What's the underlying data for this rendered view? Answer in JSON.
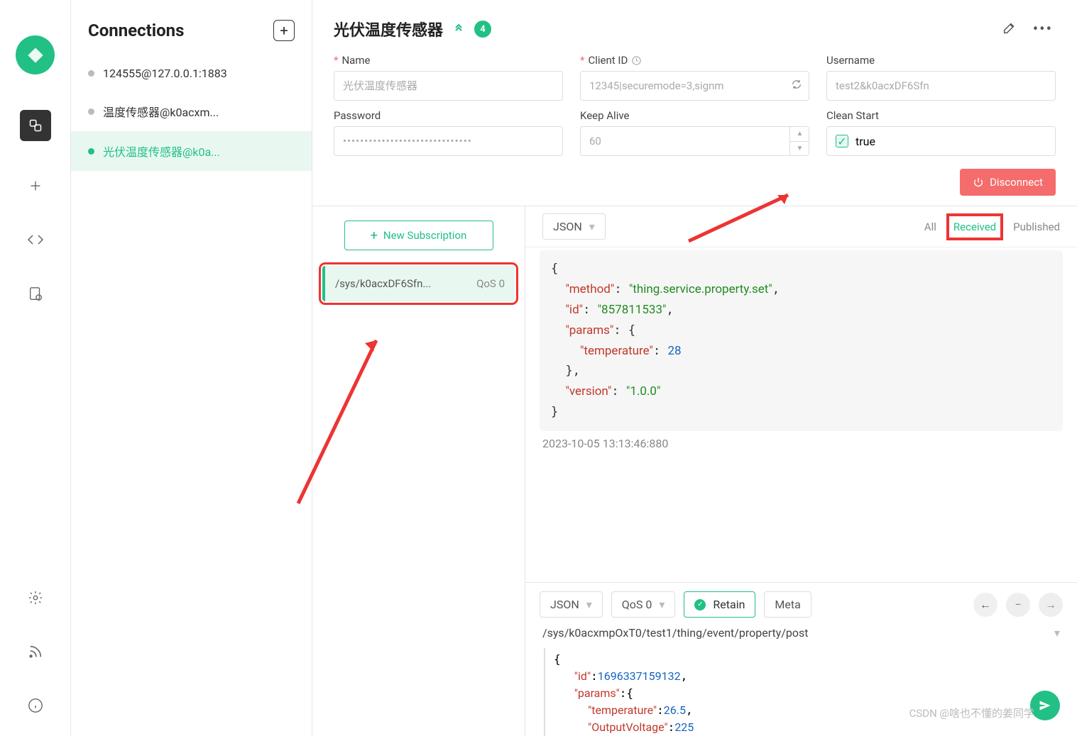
{
  "sidebar": {
    "title": "Connections",
    "items": [
      {
        "label": "124555@127.0.0.1:1883",
        "active": false
      },
      {
        "label": "温度传感器@k0acxm...",
        "active": false
      },
      {
        "label": "光伏温度传感器@k0a...",
        "active": true
      }
    ]
  },
  "header": {
    "title": "光伏温度传感器",
    "badge": "4"
  },
  "form": {
    "name_label": "Name",
    "name_placeholder": "光伏温度传感器",
    "client_label": "Client ID",
    "client_placeholder": "12345|securemode=3,signm",
    "user_label": "Username",
    "user_placeholder": "test2&k0acxDF6Sfn",
    "pass_label": "Password",
    "pass_value": "••••••••••••••••••••••••••••••",
    "keep_label": "Keep Alive",
    "keep_value": "60",
    "clean_label": "Clean Start",
    "clean_value": "true"
  },
  "buttons": {
    "disconnect": "Disconnect",
    "new_sub": "New Subscription",
    "retain": "Retain",
    "meta": "Meta"
  },
  "subscription": {
    "topic": "/sys/k0acxDF6Sfn...",
    "qos": "QoS 0"
  },
  "tabs": {
    "format": "JSON",
    "all": "All",
    "received": "Received",
    "published": "Published"
  },
  "message": {
    "timestamp": "2023-10-05 13:13:46:880",
    "json": {
      "method": "thing.service.property.set",
      "id": "857811533",
      "params": {
        "temperature": 28
      },
      "version": "1.0.0"
    }
  },
  "publish": {
    "format": "JSON",
    "qos": "QoS 0",
    "topic": "/sys/k0acxmpOxT0/test1/thing/event/property/post",
    "payload": {
      "id": 1696337159132,
      "params": {
        "temperature": 26.5,
        "OutputVoltage": 225
      }
    }
  },
  "watermark": "CSDN @啥也不懂的姜同学"
}
